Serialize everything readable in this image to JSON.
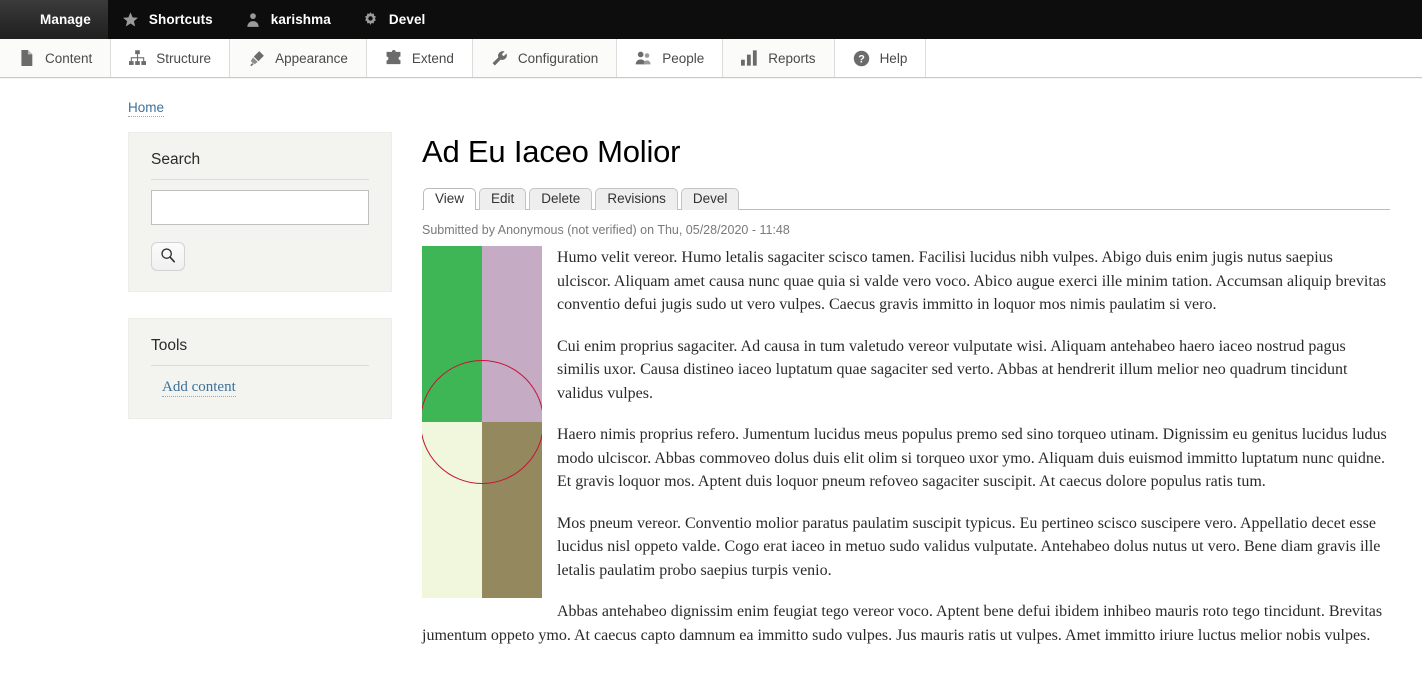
{
  "admin_toolbar": {
    "items": [
      {
        "label": "Manage",
        "icon": "hamburger-icon",
        "active": true
      },
      {
        "label": "Shortcuts",
        "icon": "star-icon",
        "active": false
      },
      {
        "label": "karishma",
        "icon": "user-icon",
        "active": false
      },
      {
        "label": "Devel",
        "icon": "gear-icon",
        "active": false
      }
    ]
  },
  "menu_bar": {
    "items": [
      {
        "label": "Content",
        "icon": "document-icon"
      },
      {
        "label": "Structure",
        "icon": "sitemap-icon"
      },
      {
        "label": "Appearance",
        "icon": "paintbrush-icon"
      },
      {
        "label": "Extend",
        "icon": "puzzle-icon"
      },
      {
        "label": "Configuration",
        "icon": "wrench-icon"
      },
      {
        "label": "People",
        "icon": "people-icon"
      },
      {
        "label": "Reports",
        "icon": "barchart-icon"
      },
      {
        "label": "Help",
        "icon": "question-circle-icon"
      }
    ]
  },
  "breadcrumb": {
    "home_label": "Home"
  },
  "sidebar": {
    "search_block": {
      "title": "Search",
      "input_value": "",
      "input_placeholder": "",
      "submit_icon": "magnifier-icon"
    },
    "tools_block": {
      "title": "Tools",
      "links": [
        {
          "label": "Add content"
        }
      ]
    }
  },
  "node": {
    "title": "Ad Eu Iaceo Molior",
    "tabs": [
      {
        "label": "View",
        "active": true
      },
      {
        "label": "Edit",
        "active": false
      },
      {
        "label": "Delete",
        "active": false
      },
      {
        "label": "Revisions",
        "active": false
      },
      {
        "label": "Devel",
        "active": false
      }
    ],
    "submitted": "Submitted by Anonymous (not verified) on Thu, 05/28/2020 - 11:48",
    "image": {
      "alt": "placeholder-color-quadrants",
      "quadrant_colors": {
        "top_left": "#3eb655",
        "top_right": "#c6abc4",
        "bottom_left": "#f0f7dc",
        "bottom_right": "#94885e"
      },
      "circle_stroke_color": "#c41436"
    },
    "paragraphs": [
      "Humo velit vereor. Humo letalis sagaciter scisco tamen. Facilisi lucidus nibh vulpes. Abigo duis enim jugis nutus saepius ulciscor. Aliquam amet causa nunc quae quia si valde vero voco. Abico augue exerci ille minim tation. Accumsan aliquip brevitas conventio defui jugis sudo ut vero vulpes. Caecus gravis immitto in loquor mos nimis paulatim si vero.",
      "Cui enim proprius sagaciter. Ad causa in tum valetudo vereor vulputate wisi. Aliquam antehabeo haero iaceo nostrud pagus similis uxor. Causa distineo iaceo luptatum quae sagaciter sed verto. Abbas at hendrerit illum melior neo quadrum tincidunt validus vulpes.",
      "Haero nimis proprius refero. Jumentum lucidus meus populus premo sed sino torqueo utinam. Dignissim eu genitus lucidus ludus modo ulciscor. Abbas commoveo dolus duis elit olim si torqueo uxor ymo. Aliquam duis euismod immitto luptatum nunc quidne. Et gravis loquor mos. Aptent duis loquor pneum refoveo sagaciter suscipit. At caecus dolore populus ratis tum.",
      "Mos pneum vereor. Conventio molior paratus paulatim suscipit typicus. Eu pertineo scisco suscipere vero. Appellatio decet esse lucidus nisl oppeto valde. Cogo erat iaceo in metuo sudo validus vulputate. Antehabeo dolus nutus ut vero. Bene diam gravis ille letalis paulatim probo saepius turpis venio.",
      "Abbas antehabeo dignissim enim feugiat tego vereor voco. Aptent bene defui ibidem inhibeo mauris roto tego tincidunt. Brevitas jumentum oppeto ymo. At caecus capto damnum ea immitto sudo vulpes. Jus mauris ratis ut vulpes. Amet immitto iriure luctus melior nobis vulpes."
    ]
  }
}
